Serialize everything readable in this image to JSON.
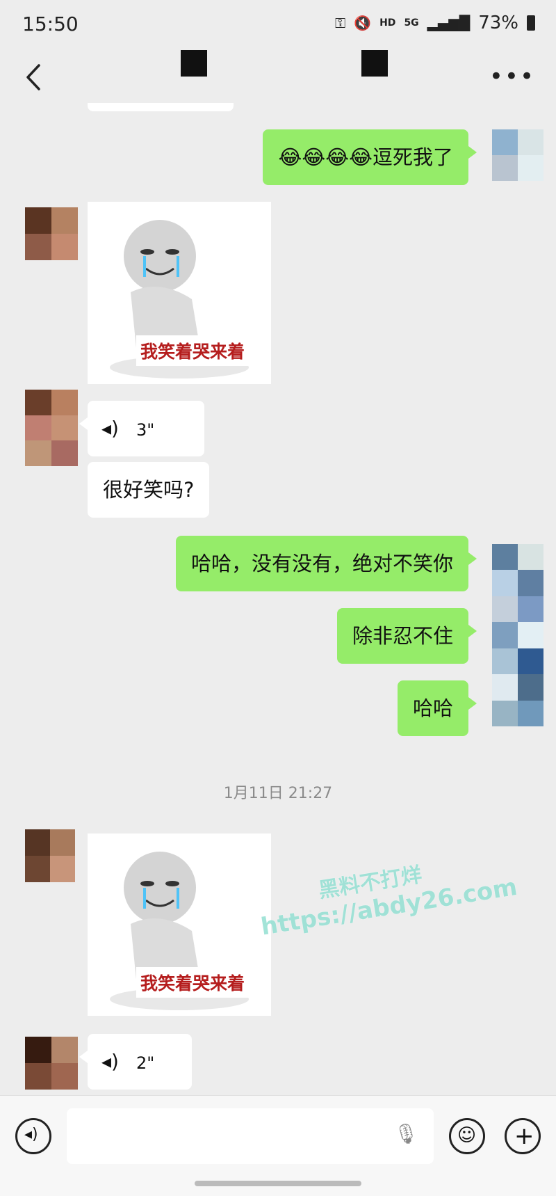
{
  "status_bar": {
    "time": "15:50",
    "network": "5G",
    "hd": "HD",
    "battery": "73%"
  },
  "messages": {
    "m1": "😂😂😂😂逗死我了",
    "sticker_caption": "我笑着哭来着",
    "voice1_duration": "3\"",
    "m2": "很好笑吗?",
    "m3": "哈哈，没有没有，绝对不笑你",
    "m4": "除非忍不住",
    "m5": "哈哈",
    "timestamp": "1月11日 21:27",
    "voice2_duration": "2\""
  },
  "watermark": {
    "line1": "黑料不打烊",
    "line2": "https://abdy26.com"
  },
  "colors": {
    "accent_green": "#95ec69",
    "background": "#ededed"
  }
}
